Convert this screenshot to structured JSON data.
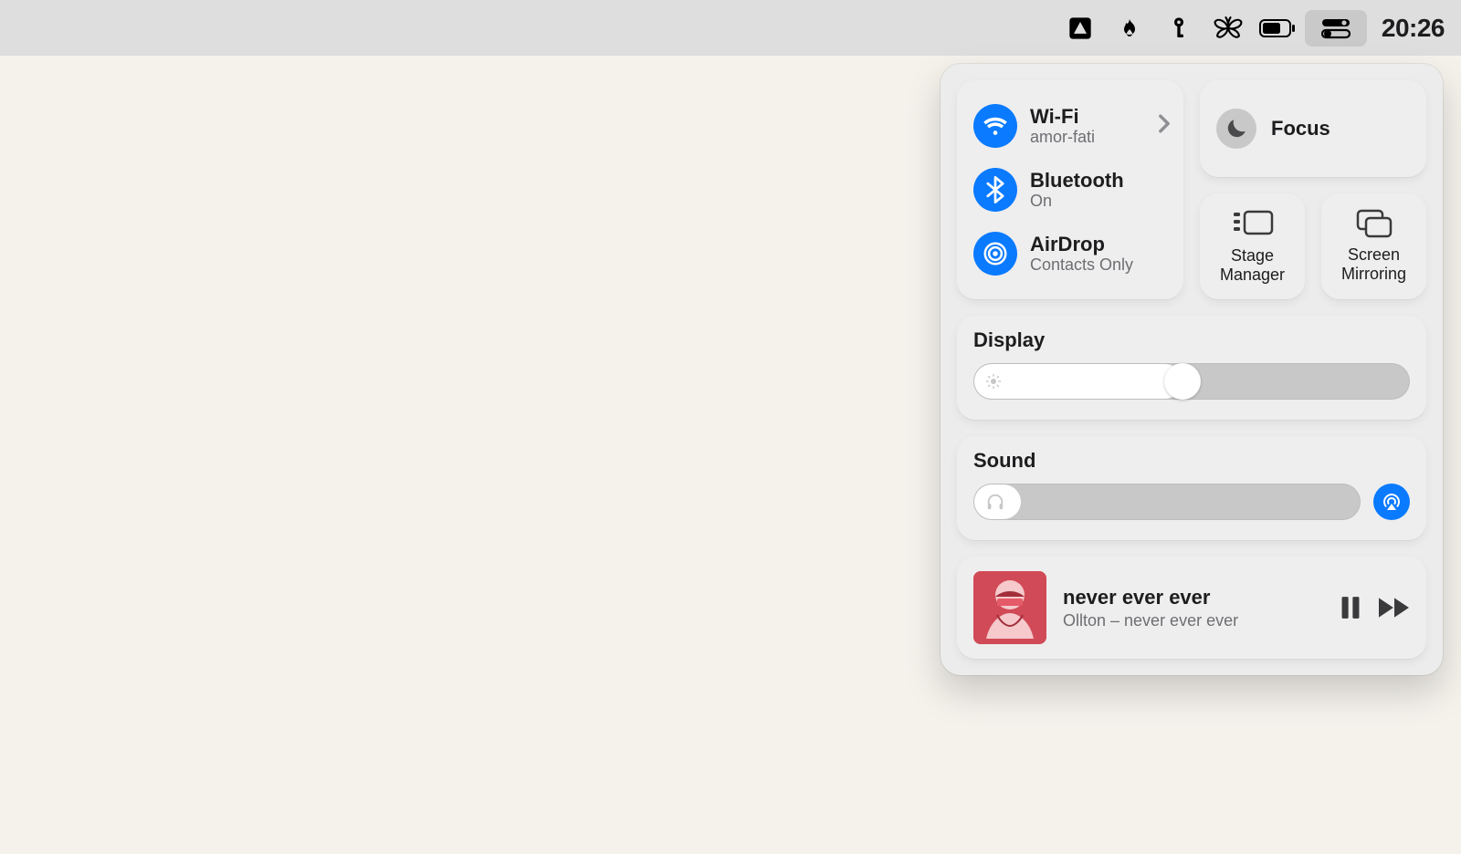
{
  "menubar": {
    "time": "20:26"
  },
  "control_center": {
    "connectivity": {
      "wifi": {
        "label": "Wi-Fi",
        "status": "amor-fati"
      },
      "bluetooth": {
        "label": "Bluetooth",
        "status": "On"
      },
      "airdrop": {
        "label": "AirDrop",
        "status": "Contacts Only"
      }
    },
    "focus": {
      "label": "Focus"
    },
    "stage_manager": {
      "label": "Stage\nManager"
    },
    "screen_mirroring": {
      "label": "Screen\nMirroring"
    },
    "display": {
      "label": "Display",
      "percent": 48
    },
    "sound": {
      "label": "Sound",
      "percent": 12
    },
    "media": {
      "title": "never ever ever",
      "subtitle": "Ollton – never ever ever",
      "playing": true
    }
  },
  "colors": {
    "accent": "#0a7aff",
    "album_tint": "#d14a57"
  }
}
